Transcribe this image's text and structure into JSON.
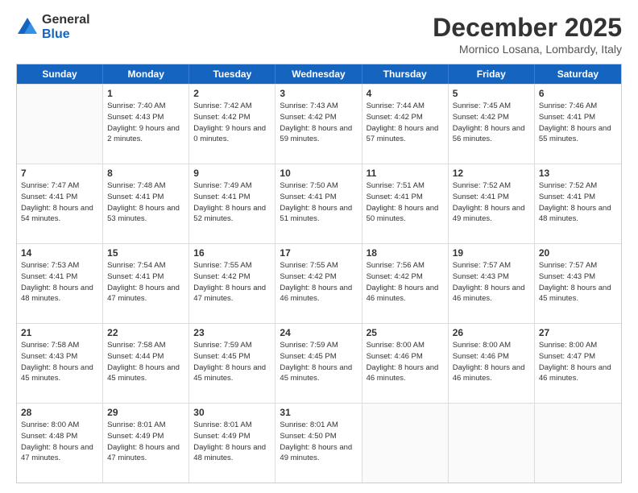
{
  "logo": {
    "general": "General",
    "blue": "Blue"
  },
  "header": {
    "month": "December 2025",
    "location": "Mornico Losana, Lombardy, Italy"
  },
  "weekdays": [
    "Sunday",
    "Monday",
    "Tuesday",
    "Wednesday",
    "Thursday",
    "Friday",
    "Saturday"
  ],
  "weeks": [
    [
      {
        "day": "",
        "empty": true
      },
      {
        "day": "1",
        "sr": "Sunrise: 7:40 AM",
        "ss": "Sunset: 4:43 PM",
        "dl": "Daylight: 9 hours and 2 minutes."
      },
      {
        "day": "2",
        "sr": "Sunrise: 7:42 AM",
        "ss": "Sunset: 4:42 PM",
        "dl": "Daylight: 9 hours and 0 minutes."
      },
      {
        "day": "3",
        "sr": "Sunrise: 7:43 AM",
        "ss": "Sunset: 4:42 PM",
        "dl": "Daylight: 8 hours and 59 minutes."
      },
      {
        "day": "4",
        "sr": "Sunrise: 7:44 AM",
        "ss": "Sunset: 4:42 PM",
        "dl": "Daylight: 8 hours and 57 minutes."
      },
      {
        "day": "5",
        "sr": "Sunrise: 7:45 AM",
        "ss": "Sunset: 4:42 PM",
        "dl": "Daylight: 8 hours and 56 minutes."
      },
      {
        "day": "6",
        "sr": "Sunrise: 7:46 AM",
        "ss": "Sunset: 4:41 PM",
        "dl": "Daylight: 8 hours and 55 minutes."
      }
    ],
    [
      {
        "day": "7",
        "sr": "Sunrise: 7:47 AM",
        "ss": "Sunset: 4:41 PM",
        "dl": "Daylight: 8 hours and 54 minutes."
      },
      {
        "day": "8",
        "sr": "Sunrise: 7:48 AM",
        "ss": "Sunset: 4:41 PM",
        "dl": "Daylight: 8 hours and 53 minutes."
      },
      {
        "day": "9",
        "sr": "Sunrise: 7:49 AM",
        "ss": "Sunset: 4:41 PM",
        "dl": "Daylight: 8 hours and 52 minutes."
      },
      {
        "day": "10",
        "sr": "Sunrise: 7:50 AM",
        "ss": "Sunset: 4:41 PM",
        "dl": "Daylight: 8 hours and 51 minutes."
      },
      {
        "day": "11",
        "sr": "Sunrise: 7:51 AM",
        "ss": "Sunset: 4:41 PM",
        "dl": "Daylight: 8 hours and 50 minutes."
      },
      {
        "day": "12",
        "sr": "Sunrise: 7:52 AM",
        "ss": "Sunset: 4:41 PM",
        "dl": "Daylight: 8 hours and 49 minutes."
      },
      {
        "day": "13",
        "sr": "Sunrise: 7:52 AM",
        "ss": "Sunset: 4:41 PM",
        "dl": "Daylight: 8 hours and 48 minutes."
      }
    ],
    [
      {
        "day": "14",
        "sr": "Sunrise: 7:53 AM",
        "ss": "Sunset: 4:41 PM",
        "dl": "Daylight: 8 hours and 48 minutes."
      },
      {
        "day": "15",
        "sr": "Sunrise: 7:54 AM",
        "ss": "Sunset: 4:41 PM",
        "dl": "Daylight: 8 hours and 47 minutes."
      },
      {
        "day": "16",
        "sr": "Sunrise: 7:55 AM",
        "ss": "Sunset: 4:42 PM",
        "dl": "Daylight: 8 hours and 47 minutes."
      },
      {
        "day": "17",
        "sr": "Sunrise: 7:55 AM",
        "ss": "Sunset: 4:42 PM",
        "dl": "Daylight: 8 hours and 46 minutes."
      },
      {
        "day": "18",
        "sr": "Sunrise: 7:56 AM",
        "ss": "Sunset: 4:42 PM",
        "dl": "Daylight: 8 hours and 46 minutes."
      },
      {
        "day": "19",
        "sr": "Sunrise: 7:57 AM",
        "ss": "Sunset: 4:43 PM",
        "dl": "Daylight: 8 hours and 46 minutes."
      },
      {
        "day": "20",
        "sr": "Sunrise: 7:57 AM",
        "ss": "Sunset: 4:43 PM",
        "dl": "Daylight: 8 hours and 45 minutes."
      }
    ],
    [
      {
        "day": "21",
        "sr": "Sunrise: 7:58 AM",
        "ss": "Sunset: 4:43 PM",
        "dl": "Daylight: 8 hours and 45 minutes."
      },
      {
        "day": "22",
        "sr": "Sunrise: 7:58 AM",
        "ss": "Sunset: 4:44 PM",
        "dl": "Daylight: 8 hours and 45 minutes."
      },
      {
        "day": "23",
        "sr": "Sunrise: 7:59 AM",
        "ss": "Sunset: 4:45 PM",
        "dl": "Daylight: 8 hours and 45 minutes."
      },
      {
        "day": "24",
        "sr": "Sunrise: 7:59 AM",
        "ss": "Sunset: 4:45 PM",
        "dl": "Daylight: 8 hours and 45 minutes."
      },
      {
        "day": "25",
        "sr": "Sunrise: 8:00 AM",
        "ss": "Sunset: 4:46 PM",
        "dl": "Daylight: 8 hours and 46 minutes."
      },
      {
        "day": "26",
        "sr": "Sunrise: 8:00 AM",
        "ss": "Sunset: 4:46 PM",
        "dl": "Daylight: 8 hours and 46 minutes."
      },
      {
        "day": "27",
        "sr": "Sunrise: 8:00 AM",
        "ss": "Sunset: 4:47 PM",
        "dl": "Daylight: 8 hours and 46 minutes."
      }
    ],
    [
      {
        "day": "28",
        "sr": "Sunrise: 8:00 AM",
        "ss": "Sunset: 4:48 PM",
        "dl": "Daylight: 8 hours and 47 minutes."
      },
      {
        "day": "29",
        "sr": "Sunrise: 8:01 AM",
        "ss": "Sunset: 4:49 PM",
        "dl": "Daylight: 8 hours and 47 minutes."
      },
      {
        "day": "30",
        "sr": "Sunrise: 8:01 AM",
        "ss": "Sunset: 4:49 PM",
        "dl": "Daylight: 8 hours and 48 minutes."
      },
      {
        "day": "31",
        "sr": "Sunrise: 8:01 AM",
        "ss": "Sunset: 4:50 PM",
        "dl": "Daylight: 8 hours and 49 minutes."
      },
      {
        "day": "",
        "empty": true
      },
      {
        "day": "",
        "empty": true
      },
      {
        "day": "",
        "empty": true
      }
    ]
  ]
}
